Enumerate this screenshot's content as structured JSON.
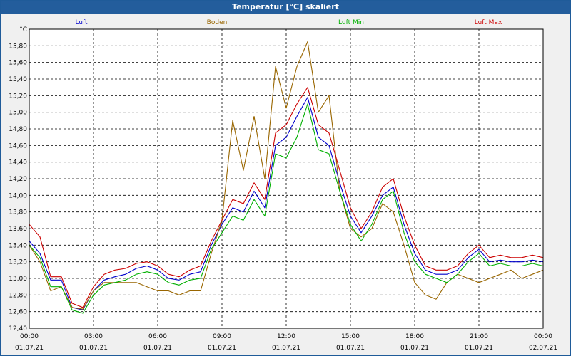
{
  "window": {
    "title": "Temperatur [°C] skaliert"
  },
  "chart_data": {
    "type": "line",
    "title": "Temperatur [°C] skaliert",
    "ylabel": "°C",
    "ylim": [
      12.4,
      16.0
    ],
    "yticks": [
      "12,40",
      "12,60",
      "12,80",
      "13,00",
      "13,20",
      "13,40",
      "13,60",
      "13,80",
      "14,00",
      "14,20",
      "14,40",
      "14,60",
      "14,80",
      "15,00",
      "15,20",
      "15,40",
      "15,60",
      "15,80"
    ],
    "xlim": [
      0,
      24
    ],
    "xticks": [
      {
        "time": "00:00",
        "date": "01.07.21"
      },
      {
        "time": "03:00",
        "date": "01.07.21"
      },
      {
        "time": "06:00",
        "date": "01.07.21"
      },
      {
        "time": "09:00",
        "date": "01.07.21"
      },
      {
        "time": "12:00",
        "date": "01.07.21"
      },
      {
        "time": "15:00",
        "date": "01.07.21"
      },
      {
        "time": "18:00",
        "date": "01.07.21"
      },
      {
        "time": "21:00",
        "date": "01.07.21"
      },
      {
        "time": "00:00",
        "date": "02.07.21"
      }
    ],
    "grid": true,
    "legend_position": "top",
    "x": [
      0,
      0.5,
      1,
      1.5,
      2,
      2.5,
      3,
      3.5,
      4,
      4.5,
      5,
      5.5,
      6,
      6.5,
      7,
      7.5,
      8,
      8.5,
      9,
      9.5,
      10,
      10.5,
      11,
      11.5,
      12,
      12.5,
      13,
      13.5,
      14,
      14.5,
      15,
      15.5,
      16,
      16.5,
      17,
      17.5,
      18,
      18.5,
      19,
      19.5,
      20,
      20.5,
      21,
      21.5,
      22,
      22.5,
      23,
      23.5,
      24
    ],
    "series": [
      {
        "name": "Luft",
        "color": "#0000cc",
        "values": [
          13.45,
          13.3,
          12.98,
          12.98,
          12.65,
          12.62,
          12.85,
          12.98,
          13.02,
          13.05,
          13.12,
          13.15,
          13.1,
          13.0,
          12.98,
          13.05,
          13.08,
          13.4,
          13.65,
          13.85,
          13.8,
          14.05,
          13.85,
          14.6,
          14.7,
          14.95,
          15.18,
          14.7,
          14.6,
          14.15,
          13.75,
          13.55,
          13.75,
          14.0,
          14.1,
          13.65,
          13.3,
          13.1,
          13.05,
          13.05,
          13.1,
          13.25,
          13.35,
          13.2,
          13.22,
          13.2,
          13.2,
          13.22,
          13.2
        ]
      },
      {
        "name": "Boden",
        "color": "#996600",
        "values": [
          13.4,
          13.2,
          12.85,
          12.9,
          12.65,
          12.63,
          12.85,
          12.95,
          12.95,
          12.95,
          12.95,
          12.9,
          12.85,
          12.85,
          12.8,
          12.85,
          12.85,
          13.3,
          13.7,
          14.9,
          14.3,
          14.95,
          14.2,
          15.55,
          15.05,
          15.55,
          15.85,
          15.0,
          15.2,
          14.05,
          13.6,
          13.5,
          13.6,
          13.9,
          13.8,
          13.4,
          12.95,
          12.8,
          12.75,
          12.95,
          13.05,
          13.0,
          12.95,
          13.0,
          13.05,
          13.1,
          13.0,
          13.05,
          13.1
        ]
      },
      {
        "name": "Luft Min",
        "color": "#00b000",
        "values": [
          13.4,
          13.25,
          12.9,
          12.9,
          12.62,
          12.58,
          12.8,
          12.92,
          12.95,
          12.98,
          13.05,
          13.08,
          13.05,
          12.95,
          12.92,
          12.98,
          13.0,
          13.35,
          13.55,
          13.75,
          13.7,
          13.95,
          13.75,
          14.5,
          14.45,
          14.7,
          15.1,
          14.55,
          14.5,
          14.05,
          13.65,
          13.45,
          13.65,
          13.95,
          14.05,
          13.55,
          13.2,
          13.05,
          13.0,
          12.95,
          13.05,
          13.2,
          13.3,
          13.15,
          13.18,
          13.15,
          13.15,
          13.18,
          13.15
        ]
      },
      {
        "name": "Luft Max",
        "color": "#cc0000",
        "values": [
          13.65,
          13.5,
          13.02,
          13.02,
          12.7,
          12.65,
          12.9,
          13.05,
          13.1,
          13.12,
          13.18,
          13.2,
          13.15,
          13.05,
          13.02,
          13.1,
          13.15,
          13.45,
          13.7,
          13.95,
          13.9,
          14.15,
          13.95,
          14.75,
          14.85,
          15.1,
          15.3,
          14.85,
          14.75,
          14.3,
          13.85,
          13.6,
          13.8,
          14.1,
          14.2,
          13.75,
          13.4,
          13.15,
          13.1,
          13.1,
          13.15,
          13.3,
          13.4,
          13.25,
          13.28,
          13.25,
          13.25,
          13.28,
          13.25
        ]
      }
    ]
  }
}
